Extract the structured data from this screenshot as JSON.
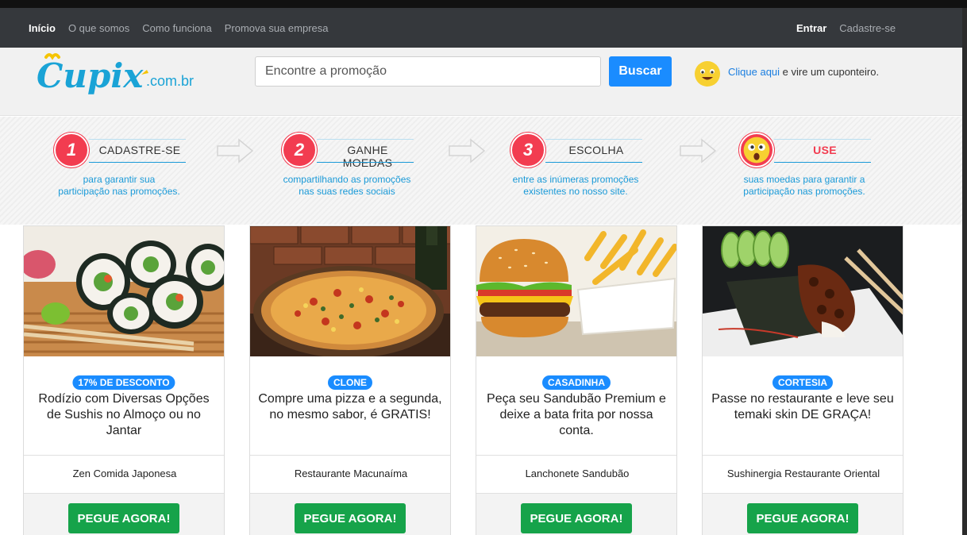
{
  "nav": {
    "left": [
      "Início",
      "O que somos",
      "Como funciona",
      "Promova sua empresa"
    ],
    "right": [
      "Entrar",
      "Cadastre-se"
    ]
  },
  "header": {
    "logo_text": "Cupix",
    "logo_domain": ".com.br",
    "search_placeholder": "Encontre a promoção",
    "search_button": "Buscar",
    "cta_link": "Clique aqui",
    "cta_rest": " e vire um cuponteiro."
  },
  "steps": [
    {
      "number": "1",
      "title": "CADASTRE-SE",
      "desc_line1": "para garantir sua",
      "desc_line2": "participação nas promoções."
    },
    {
      "number": "2",
      "title": "GANHE MOEDAS",
      "desc_line1": "compartilhando as promoções",
      "desc_line2": "nas suas redes sociais"
    },
    {
      "number": "3",
      "title": "ESCOLHA",
      "desc_line1": "entre as inúmeras promoções",
      "desc_line2": "existentes no nosso site."
    },
    {
      "number": "",
      "title": "USE",
      "desc_line1": "suas moedas para garantir a",
      "desc_line2": "participação nas promoções."
    }
  ],
  "cards": [
    {
      "image": "sushi-rolls-photo",
      "badge": "17% DE DESCONTO",
      "title": "Rodízio com Diversas Opções de Sushis no Almoço ou no Jantar",
      "venue": "Zen Comida Japonesa",
      "button": "PEGUE AGORA!"
    },
    {
      "image": "pizza-photo",
      "badge": "CLONE",
      "title": "Compre uma pizza e a segunda, no mesmo sabor, é GRATIS!",
      "venue": "Restaurante Macunaíma",
      "button": "PEGUE AGORA!"
    },
    {
      "image": "burger-fries-photo",
      "badge": "CASADINHA",
      "title": "Peça seu Sandubão Premium e deixe a bata frita por nossa conta.",
      "venue": "Lanchonete Sandubão",
      "button": "PEGUE AGORA!"
    },
    {
      "image": "temaki-photo",
      "badge": "CORTESIA",
      "title": "Passe no restaurante e leve seu temaki skin DE GRAÇA!",
      "venue": "Sushinergia Restaurante Oriental",
      "button": "PEGUE AGORA!"
    }
  ],
  "colors": {
    "accent": "#1a8cff",
    "step_red": "#f23c50",
    "button_green": "#16a34a",
    "nav_bg": "#35383c",
    "link_blue": "#1a9ad8"
  }
}
